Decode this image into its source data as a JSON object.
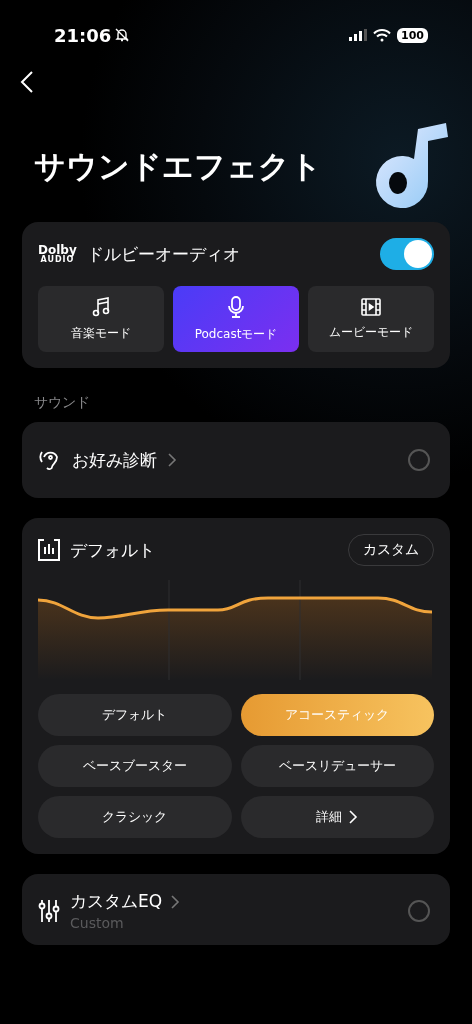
{
  "status_bar": {
    "time": "21:06",
    "battery": "100"
  },
  "header": {
    "title": "サウンドエフェクト"
  },
  "dolby": {
    "logo_text": "Dolby",
    "logo_subtext": "AUDIO",
    "label": "ドルビーオーディオ",
    "on": true,
    "modes": [
      {
        "label": "音楽モード",
        "kind": "music",
        "selected": false
      },
      {
        "label": "Podcastモード",
        "kind": "podcast",
        "selected": true
      },
      {
        "label": "ムービーモード",
        "kind": "movie",
        "selected": false
      }
    ]
  },
  "section_label": "サウンド",
  "preference": {
    "label": "お好み診断",
    "selected": false
  },
  "eq": {
    "title": "デフォルト",
    "custom_button": "カスタム",
    "presets": [
      {
        "label": "デフォルト",
        "selected": false
      },
      {
        "label": "アコースティック",
        "selected": true
      },
      {
        "label": "ベースブースター",
        "selected": false
      },
      {
        "label": "ベースリデューサー",
        "selected": false
      },
      {
        "label": "クラシック",
        "selected": false
      },
      {
        "label": "詳細",
        "selected": false,
        "kind": "more"
      }
    ]
  },
  "custom_eq": {
    "label": "カスタムEQ",
    "sublabel": "Custom",
    "selected": false
  }
}
